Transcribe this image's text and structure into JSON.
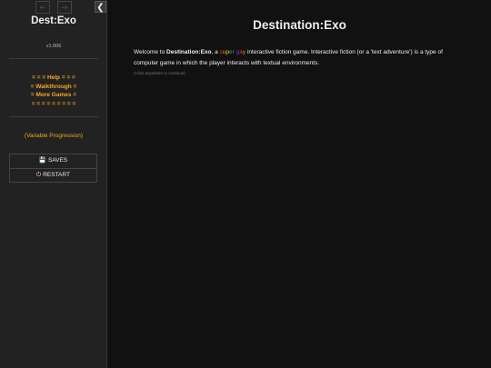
{
  "sidebar": {
    "history_back_icon": "arrow-left-icon",
    "history_forward_icon": "arrow-right-icon",
    "stow_icon": "chevron-left-icon",
    "title": "Dest:Exo",
    "version": "v1.006",
    "links": [
      "= = = Help = = =",
      "= Walkthrough =",
      "= More Games =",
      "= = = = = = = = ="
    ],
    "variable_progression": "(Variable Progression)",
    "saves_label": "SAVES",
    "saves_icon": "floppy-disk-icon",
    "restart_label": "RESTART",
    "restart_icon": "power-icon",
    "colors": {
      "link": "#f5a623",
      "background": "#222222"
    }
  },
  "passage": {
    "title": "Destination:Exo",
    "intro_before": "Welcome to ",
    "intro_game": "Destination:Exo",
    "intro_mid": ", a ",
    "rainbow_word": "super gay",
    "rainbow_colors": [
      "#e53935",
      "#fb8c00",
      "#fdd835",
      "#43a047",
      "#1e88e5",
      "#8e24aa",
      "#e53935",
      "#fb8c00",
      "#43a047"
    ],
    "intro_after": " interactive fiction game. Interactive fiction (or a 'text adventure') is a type of computer game in which the player interacts with textual environments.",
    "continue_hint": "(Click anywhere to continue)"
  }
}
